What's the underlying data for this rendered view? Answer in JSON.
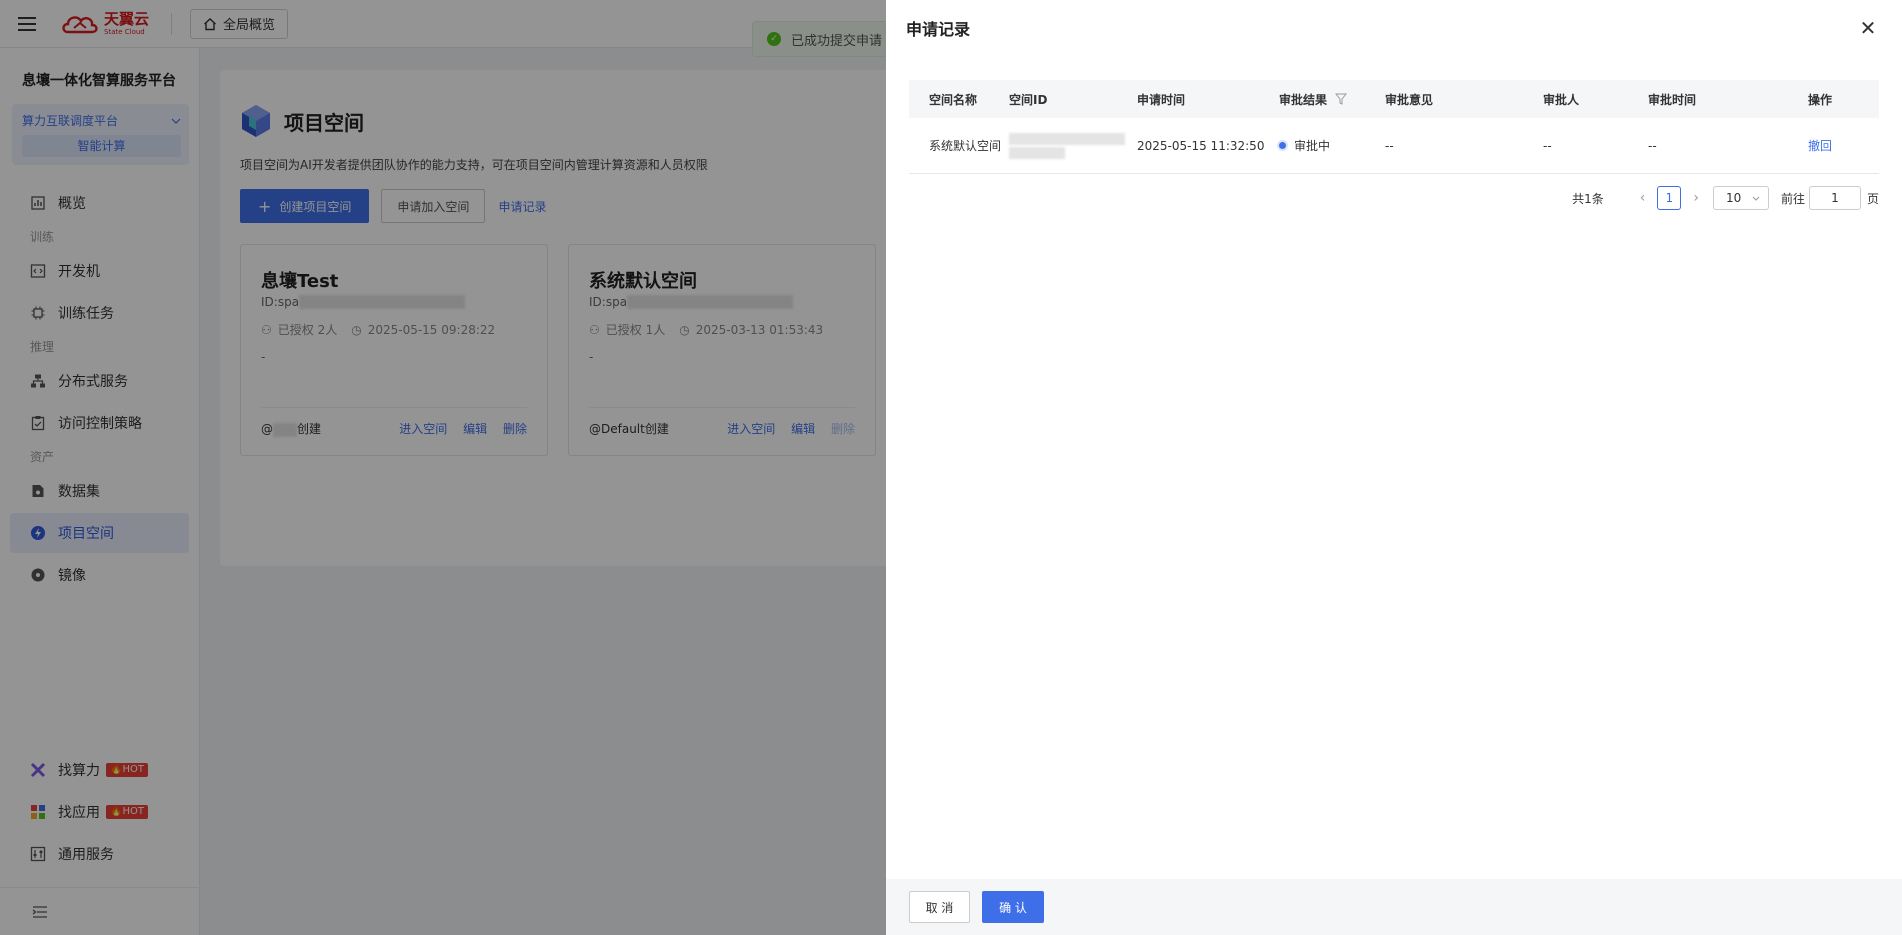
{
  "topbar": {
    "logo_cn": "天翼云",
    "logo_en": "State Cloud",
    "overview_label": "全局概览",
    "toast_text": "已成功提交申请"
  },
  "sidebar": {
    "platform_title": "息壤一体化智算服务平台",
    "switcher_label": "算力互联调度平台",
    "switcher_sub": "智能计算",
    "items": [
      {
        "label": "概览",
        "icon": "chart-icon"
      },
      {
        "group": "训练"
      },
      {
        "label": "开发机",
        "icon": "code-icon"
      },
      {
        "label": "训练任务",
        "icon": "chip-icon"
      },
      {
        "group": "推理"
      },
      {
        "label": "分布式服务",
        "icon": "network-icon"
      },
      {
        "label": "访问控制策略",
        "icon": "clipboard-icon"
      },
      {
        "group": "资产"
      },
      {
        "label": "数据集",
        "icon": "dataset-icon"
      },
      {
        "label": "项目空间",
        "icon": "bolt-icon",
        "active": true
      },
      {
        "label": "镜像",
        "icon": "disc-icon"
      }
    ],
    "bottom_items": [
      {
        "label": "找算力",
        "badge": "HOT"
      },
      {
        "label": "找应用",
        "badge": "HOT"
      },
      {
        "label": "通用服务"
      }
    ]
  },
  "main": {
    "title": "项目空间",
    "description": "项目空间为AI开发者提供团队协作的能力支持，可在项目空间内管理计算资源和人员权限",
    "create_label": "创建项目空间",
    "join_label": "申请加入空间",
    "records_label": "申请记录",
    "spaces": [
      {
        "name": "息壤Test",
        "id_prefix": "ID:spa",
        "authorized": "已授权 2人",
        "time": "2025-05-15 09:28:22",
        "desc": "-",
        "creator_prefix": "@",
        "creator_suffix": "创建",
        "enter": "进入空间",
        "edit": "编辑",
        "delete": "删除"
      },
      {
        "name": "系统默认空间",
        "id_prefix": "ID:spa",
        "authorized": "已授权 1人",
        "time": "2025-03-13 01:53:43",
        "desc": "-",
        "creator_prefix": "@Default",
        "creator_suffix": "创建",
        "enter": "进入空间",
        "edit": "编辑",
        "delete": "删除"
      }
    ]
  },
  "drawer": {
    "title": "申请记录",
    "columns": [
      "空间名称",
      "空间ID",
      "申请时间",
      "审批结果",
      "审批意见",
      "审批人",
      "审批时间",
      "操作"
    ],
    "row": {
      "space_name": "系统默认空间",
      "apply_time": "2025-05-15 11:32:50",
      "result": "审批中",
      "opinion": "--",
      "approver": "--",
      "approve_time": "--",
      "action": "撤回"
    },
    "pager": {
      "total": "共1条",
      "current": "1",
      "page_size": "10",
      "goto_label": "前往",
      "goto_value": "1",
      "page_unit": "页"
    },
    "cancel_label": "取 消",
    "confirm_label": "确 认"
  },
  "colors": {
    "accent": "#3f6fe8",
    "brand": "#d71920",
    "hot": "#e8413a"
  }
}
